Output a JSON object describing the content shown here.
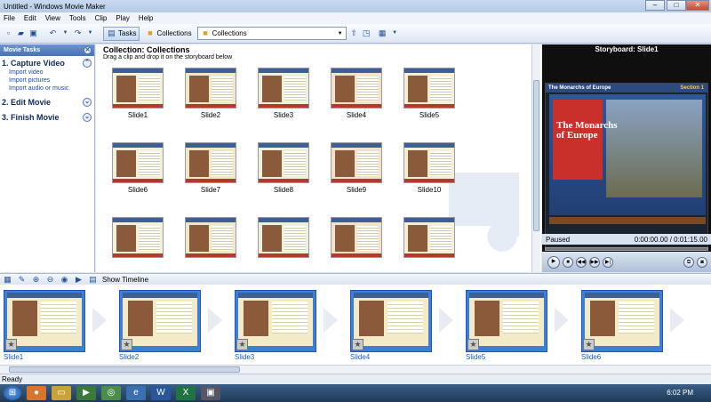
{
  "window": {
    "title": "Untitled - Windows Movie Maker"
  },
  "menu": [
    "File",
    "Edit",
    "View",
    "Tools",
    "Clip",
    "Play",
    "Help"
  ],
  "toolbar": {
    "tasks_label": "Tasks",
    "collections_label": "Collections",
    "collection_select": "Collections"
  },
  "tasks_pane": {
    "header": "Movie Tasks",
    "sections": [
      {
        "title": "1. Capture Video",
        "links": [
          "Import video",
          "Import pictures",
          "Import audio or music"
        ]
      },
      {
        "title": "2. Edit Movie",
        "links": []
      },
      {
        "title": "3. Finish Movie",
        "links": []
      }
    ]
  },
  "collection": {
    "title": "Collection: Collections",
    "hint": "Drag a clip and drop it on the storyboard below",
    "items": [
      "Slide1",
      "Slide2",
      "Slide3",
      "Slide4",
      "Slide5",
      "Slide6",
      "Slide7",
      "Slide8",
      "Slide9",
      "Slide10",
      "",
      "",
      "",
      "",
      ""
    ]
  },
  "preview": {
    "title": "Storyboard: Slide1",
    "slide_heading": "The Monarchs of Europe",
    "slide_section": "Section 1",
    "slide_main": "The Monarchs of Europe",
    "status": "Paused",
    "time": "0:00:00.00 / 0:01:15.00"
  },
  "storyboard": {
    "show_timeline": "Show Timeline",
    "cells": [
      "Slide1",
      "Slide2",
      "Slide3",
      "Slide4",
      "Slide5",
      "Slide6"
    ]
  },
  "statusbar": {
    "text": "Ready"
  },
  "taskbar": {
    "clock": "6:02 PM"
  }
}
